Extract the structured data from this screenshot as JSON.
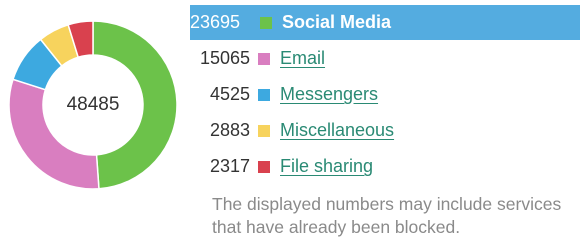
{
  "chart_data": {
    "type": "pie",
    "center_label": "48485",
    "series": [
      {
        "name": "Social Media",
        "value": 23695,
        "color": "#6cc24a"
      },
      {
        "name": "Email",
        "value": 15065,
        "color": "#d97ec0"
      },
      {
        "name": "Messengers",
        "value": 4525,
        "color": "#3da9e0"
      },
      {
        "name": "Miscellaneous",
        "value": 2883,
        "color": "#f7d35d"
      },
      {
        "name": "File sharing",
        "value": 2317,
        "color": "#d9414e"
      }
    ]
  },
  "legend": {
    "items": [
      {
        "count": "23695",
        "label": "Social Media",
        "color": "#6cc24a",
        "active": true
      },
      {
        "count": "15065",
        "label": "Email",
        "color": "#d97ec0",
        "active": false
      },
      {
        "count": "4525",
        "label": "Messengers",
        "color": "#3da9e0",
        "active": false
      },
      {
        "count": "2883",
        "label": "Miscellaneous",
        "color": "#f7d35d",
        "active": false
      },
      {
        "count": "2317",
        "label": "File sharing",
        "color": "#d9414e",
        "active": false
      }
    ]
  },
  "note": "The displayed numbers may include services that have already been blocked."
}
